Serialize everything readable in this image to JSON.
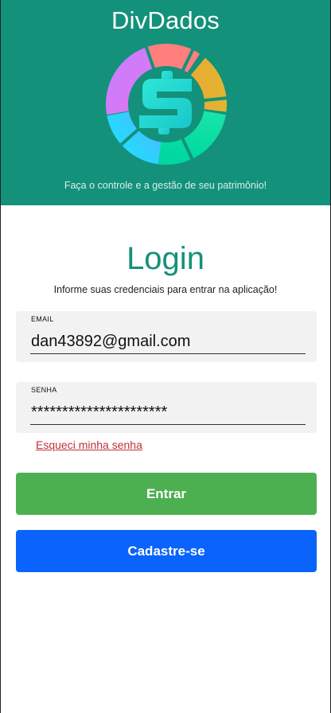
{
  "header": {
    "app_title": "DivDados",
    "tagline": "Faça o controle e a gestão de seu patrimônio!",
    "background_color": "#14917a",
    "logo_icon": "dollar-ring-logo-icon"
  },
  "login": {
    "title": "Login",
    "subtitle": "Informe suas credenciais para entrar na aplicação!",
    "email": {
      "label": "EMAIL",
      "value": "dan43892@gmail.com"
    },
    "senha": {
      "label": "SENHA",
      "value": "**********************"
    },
    "forgot_label": "Esqueci minha senha",
    "entrar_label": "Entrar",
    "cadastrar_label": "Cadastre-se"
  },
  "colors": {
    "accent": "#14917a",
    "entrar": "#4caf50",
    "cadastrar": "#0a63fb",
    "forgot_link": "#c0303a"
  }
}
